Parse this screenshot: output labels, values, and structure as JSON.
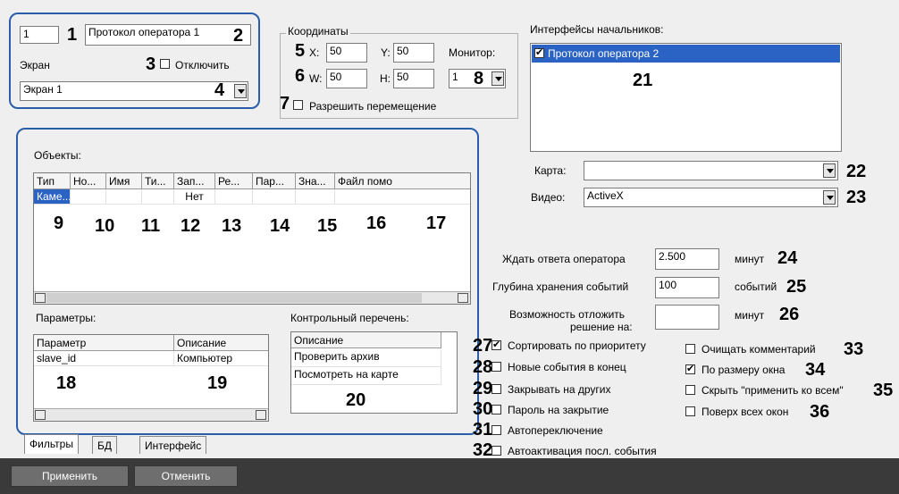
{
  "general": {
    "id_value": "1",
    "name_value": "Протокол оператора 1",
    "screen_label": "Экран",
    "disable_label": "Отключить",
    "screen_value": "Экран 1"
  },
  "coords": {
    "title": "Координаты",
    "x_label": "X:",
    "x_value": "50",
    "y_label": "Y:",
    "y_value": "50",
    "w_label": "W:",
    "w_value": "50",
    "h_label": "H:",
    "h_value": "50",
    "monitor_label": "Монитор:",
    "monitor_value": "1",
    "allow_move_label": "Разрешить перемещение"
  },
  "supervisors": {
    "title": "Интерфейсы начальников:",
    "items": [
      {
        "label": "Протокол оператора 2",
        "checked": true
      }
    ]
  },
  "map": {
    "label": "Карта:",
    "value": ""
  },
  "video": {
    "label": "Видео:",
    "value": "ActiveX"
  },
  "objects": {
    "title": "Объекты:",
    "columns": [
      "Тип",
      "Но...",
      "Имя",
      "Ти...",
      "Зап...",
      "Ре...",
      "Пар...",
      "Зна...",
      "Файл помо"
    ],
    "rows": [
      [
        "Каме...",
        "",
        "",
        "",
        "Нет",
        "",
        "",
        "",
        ""
      ]
    ]
  },
  "params": {
    "title": "Параметры:",
    "columns": [
      "Параметр",
      "Описание"
    ],
    "rows": [
      [
        "slave_id",
        "Компьютер"
      ]
    ]
  },
  "checklist": {
    "title": "Контрольный перечень:",
    "column": "Описание",
    "rows": [
      "Проверить архив",
      "Посмотреть на карте"
    ]
  },
  "timing": {
    "wait_label": "Ждать ответа оператора",
    "wait_value": "2.500",
    "wait_unit": "минут",
    "depth_label": "Глубина хранения событий",
    "depth_value": "100",
    "depth_unit": "событий",
    "postpone_label_1": "Возможность отложить",
    "postpone_label_2": "решение на:",
    "postpone_value": "",
    "postpone_unit": "минут"
  },
  "options_left": [
    {
      "label": "Сортировать по приоритету",
      "checked": true
    },
    {
      "label": "Новые события в конец",
      "checked": false
    },
    {
      "label": "Закрывать на других",
      "checked": false
    },
    {
      "label": "Пароль на закрытие",
      "checked": false
    },
    {
      "label": "Автопереключение",
      "checked": false
    },
    {
      "label": "Автоактивация посл. события",
      "checked": false
    }
  ],
  "options_right": [
    {
      "label": "Очищать комментарий",
      "checked": false
    },
    {
      "label": "По размеру окна",
      "checked": true
    },
    {
      "label": "Скрыть \"применить ко всем\"",
      "checked": false
    },
    {
      "label": "Поверх всех окон",
      "checked": false
    }
  ],
  "tabs": [
    "Фильтры",
    "БД",
    "Интерфейс"
  ],
  "buttons": {
    "apply": "Применить",
    "cancel": "Отменить"
  },
  "markers": [
    "1",
    "2",
    "3",
    "4",
    "5",
    "6",
    "7",
    "8",
    "9",
    "10",
    "11",
    "12",
    "13",
    "14",
    "15",
    "16",
    "17",
    "18",
    "19",
    "20",
    "21",
    "22",
    "23",
    "24",
    "25",
    "26",
    "27",
    "28",
    "29",
    "30",
    "31",
    "32",
    "33",
    "34",
    "35",
    "36"
  ]
}
